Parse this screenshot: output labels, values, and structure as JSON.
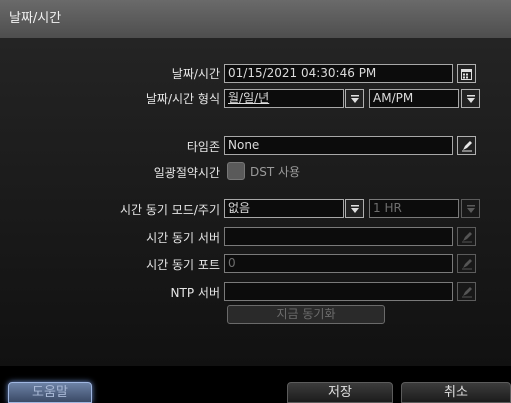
{
  "window": {
    "title": "날짜/시간"
  },
  "form": {
    "date_time": {
      "label": "날짜/시간",
      "value": "01/15/2021 04:30:46 PM"
    },
    "date_format": {
      "label": "날짜/시간 형식",
      "date_value": "월/일/년",
      "time_value": "AM/PM"
    },
    "timezone": {
      "label": "타임존",
      "value": "None"
    },
    "dst": {
      "label": "일광절약시간",
      "checkbox_label": "DST 사용",
      "checked": false
    },
    "sync_mode": {
      "label": "시간 동기 모드/주기",
      "mode_value": "없음",
      "period_value": "1 HR"
    },
    "sync_server": {
      "label": "시간 동기 서버",
      "value": ""
    },
    "sync_port": {
      "label": "시간 동기 포트",
      "value": "0"
    },
    "ntp_server": {
      "label": "NTP 서버",
      "value": ""
    },
    "sync_now_button": "지금 동기화"
  },
  "footer": {
    "help": "도움말",
    "save": "저장",
    "cancel": "취소"
  },
  "colors": {
    "title_bar": "#5a5a5a",
    "panel": "#1b1b1b",
    "help_highlight": "#6e8fd0"
  },
  "icons": {
    "calendar": "calendar-icon",
    "dropdown": "dropdown-arrow-icon",
    "edit": "edit-pencil-icon"
  }
}
